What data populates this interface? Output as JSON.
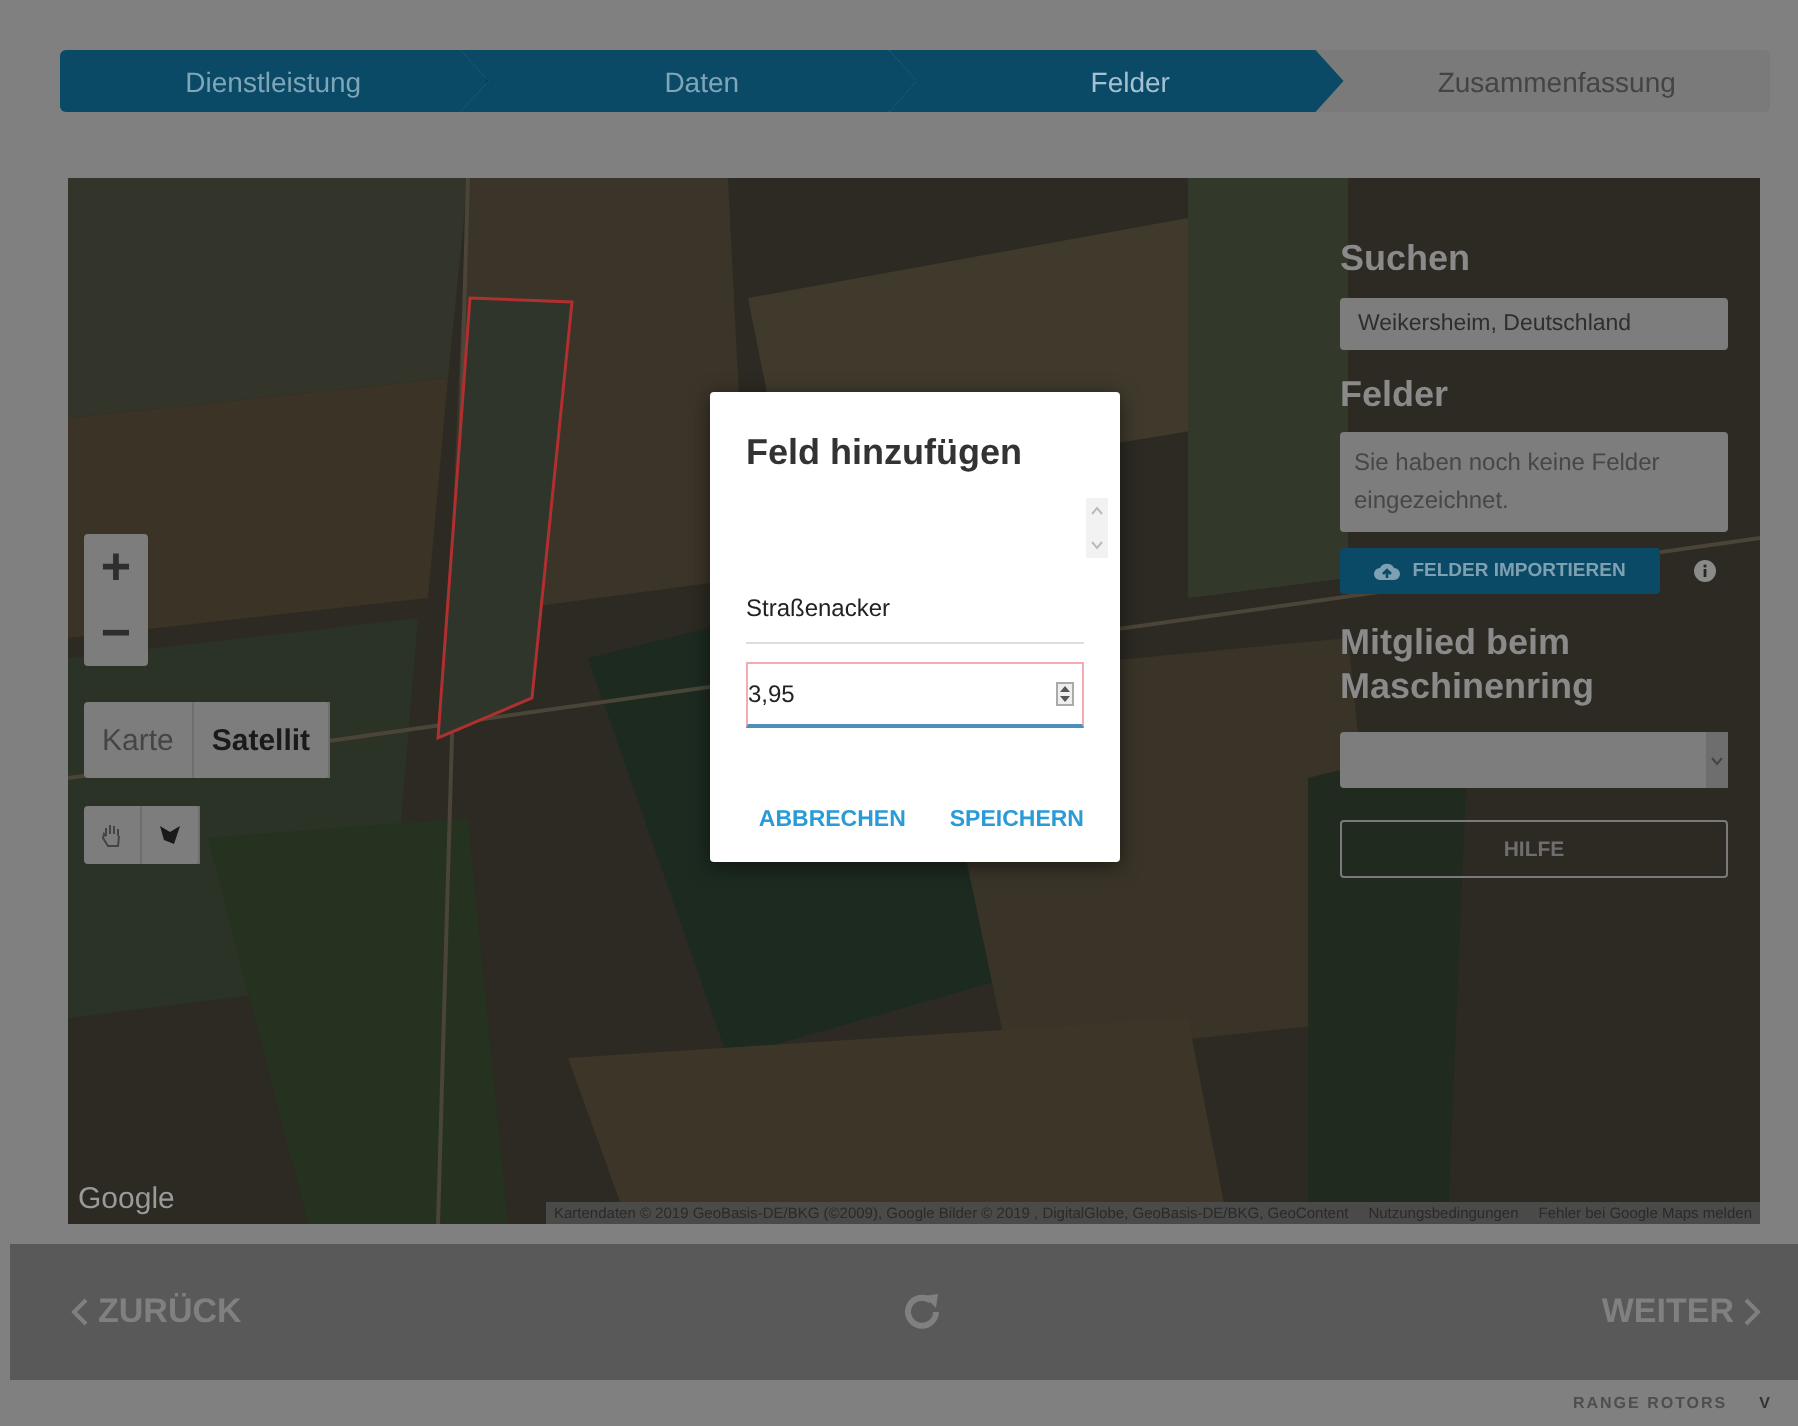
{
  "steps": [
    {
      "label": "Dienstleistung",
      "completed": true,
      "selected": false
    },
    {
      "label": "Daten",
      "completed": true,
      "selected": false
    },
    {
      "label": "Felder",
      "completed": false,
      "selected": true
    },
    {
      "label": "Zusammenfassung",
      "completed": false,
      "selected": false
    }
  ],
  "map": {
    "zoom_in": "+",
    "zoom_out": "−",
    "map_types": [
      {
        "label": "Karte",
        "selected": false
      },
      {
        "label": "Satellit",
        "selected": true
      }
    ],
    "tools": [
      {
        "kind": "hand",
        "selected": false
      },
      {
        "kind": "polygon",
        "selected": false
      }
    ],
    "logo": "Google",
    "attribution": "Kartendaten © 2019 GeoBasis-DE/BKG (©2009), Google Bilder © 2019 , DigitalGlobe, GeoBasis-DE/BKG, GeoContent",
    "links": [
      "Nutzungsbedingungen",
      "Fehler bei Google Maps melden"
    ]
  },
  "panel": {
    "search_heading": "Suchen",
    "search_value": "Weikersheim, Deutschland",
    "fields_heading": "Felder",
    "fields_placeholder": "Sie haben noch keine Felder eingezeichnet.",
    "import_button": "FELDER IMPORTIEREN",
    "member_heading": "Mitglied beim Maschinenring",
    "help_button": "HILFE"
  },
  "dialog": {
    "title": "Feld hinzufügen",
    "field_name": "Straßenacker",
    "area_value": "3,95",
    "buttons": [
      "ABBRECHEN",
      "SPEICHERN"
    ]
  },
  "footer": {
    "back": "ZURÜCK",
    "next": "WEITER"
  },
  "brand": {
    "logo": "RANGE ROTORS",
    "version": "V"
  }
}
